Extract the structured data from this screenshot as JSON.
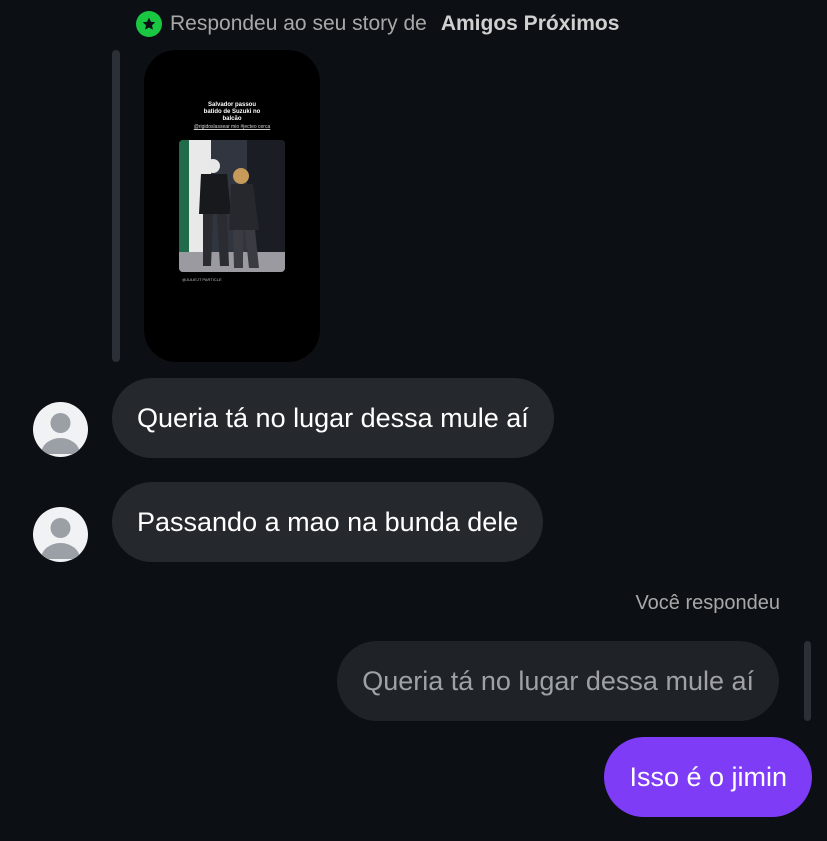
{
  "story_reply": {
    "prefix": "Respondeu ao seu story de",
    "audience": "Amigos Próximos",
    "badge_icon": "star-icon",
    "badge_color": "#1ac742"
  },
  "story": {
    "caption": "Salvador passou batido de Suzuki no balcão",
    "handles": "@rigidoslassear mio #jecteo cerca",
    "credit": "@JULIEJT PARTICLE"
  },
  "messages": [
    {
      "sender": "them",
      "text": "Queria tá no lugar dessa mule aí"
    },
    {
      "sender": "them",
      "text": "Passando a mao na bunda dele"
    }
  ],
  "you_replied": {
    "label": "Você respondeu",
    "quoted_text": "Queria tá no lugar dessa mule aí"
  },
  "outgoing": {
    "text": "Isso é o jimin"
  },
  "colors": {
    "background": "#0c1014",
    "incoming_bubble": "#25292e",
    "outgoing_bubble": "#7e3cf7"
  }
}
